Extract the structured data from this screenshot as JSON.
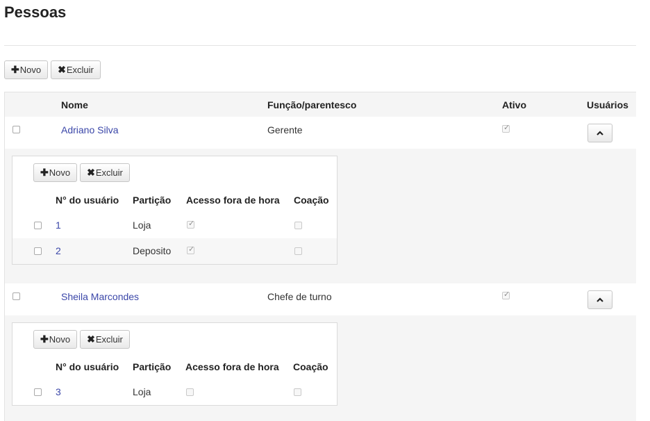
{
  "page": {
    "title": "Pessoas"
  },
  "toolbar": {
    "new_label": "Novo",
    "delete_label": "Excluir"
  },
  "table": {
    "headers": {
      "name": "Nome",
      "role": "Função/parentesco",
      "active": "Ativo",
      "users": "Usuários"
    },
    "people": [
      {
        "name": "Adriano Silva",
        "role": "Gerente",
        "active": true,
        "sub": {
          "new_label": "Novo",
          "delete_label": "Excluir",
          "headers": {
            "user_no": "N° do usuário",
            "partition": "Partição",
            "after_hours": "Acesso fora de hora",
            "duress": "Coação"
          },
          "rows": [
            {
              "user_no": "1",
              "partition": "Loja",
              "after_hours": true,
              "duress": false
            },
            {
              "user_no": "2",
              "partition": "Deposito",
              "after_hours": true,
              "duress": false
            }
          ]
        }
      },
      {
        "name": "Sheila Marcondes",
        "role": "Chefe de turno",
        "active": true,
        "sub": {
          "new_label": "Novo",
          "delete_label": "Excluir",
          "headers": {
            "user_no": "N° do usuário",
            "partition": "Partição",
            "after_hours": "Acesso fora de hora",
            "duress": "Coação"
          },
          "rows": [
            {
              "user_no": "3",
              "partition": "Loja",
              "after_hours": false,
              "duress": false
            }
          ]
        }
      }
    ]
  },
  "icons": {
    "new": "plus-icon",
    "delete": "x-icon",
    "collapse": "chevron-up-icon"
  }
}
